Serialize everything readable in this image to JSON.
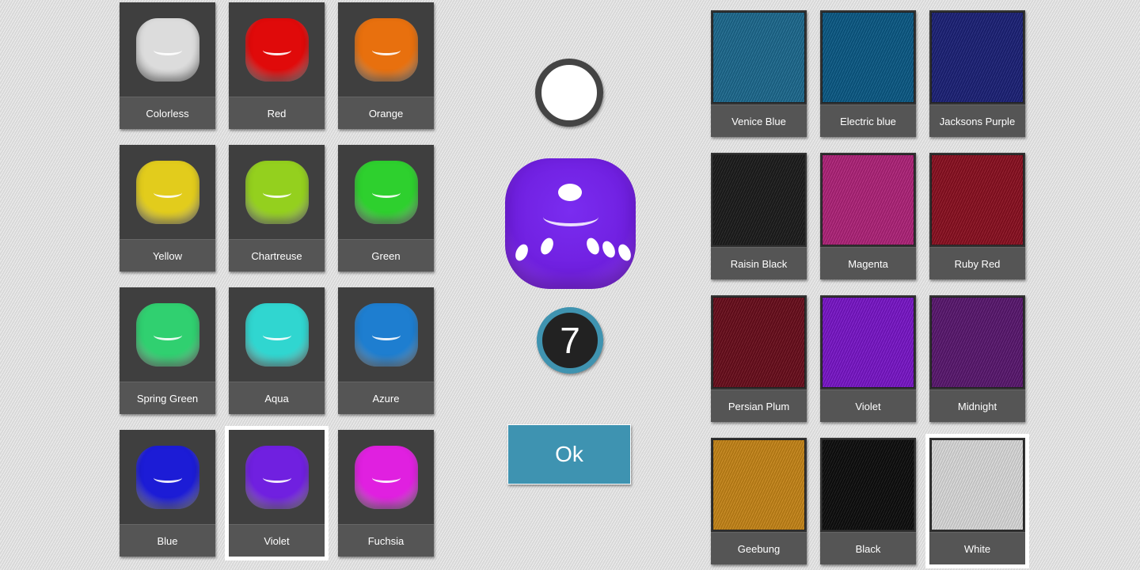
{
  "dice_colors": [
    {
      "label": "Colorless",
      "color": "#dcdcdc"
    },
    {
      "label": "Red",
      "color": "#e00a0a"
    },
    {
      "label": "Orange",
      "color": "#e8700e"
    },
    {
      "label": "Yellow",
      "color": "#e2cc1c"
    },
    {
      "label": "Chartreuse",
      "color": "#94d01e"
    },
    {
      "label": "Green",
      "color": "#2ed02e"
    },
    {
      "label": "Spring Green",
      "color": "#30d070"
    },
    {
      "label": "Aqua",
      "color": "#30d6d0"
    },
    {
      "label": "Azure",
      "color": "#1e7ed0"
    },
    {
      "label": "Blue",
      "color": "#1c1cd6"
    },
    {
      "label": "Violet",
      "color": "#7020e0",
      "selected": true
    },
    {
      "label": "Fuchsia",
      "color": "#e020e0"
    }
  ],
  "table_colors": [
    {
      "label": "Venice Blue",
      "color": "#1d6a8f"
    },
    {
      "label": "Electric blue",
      "color": "#0b5a86"
    },
    {
      "label": "Jacksons Purple",
      "color": "#1c2278"
    },
    {
      "label": "Raisin Black",
      "color": "#1c1c1c"
    },
    {
      "label": "Magenta",
      "color": "#b0237a"
    },
    {
      "label": "Ruby Red",
      "color": "#8b1021"
    },
    {
      "label": "Persian Plum",
      "color": "#6a0e1c"
    },
    {
      "label": "Violet",
      "color": "#7a16c9"
    },
    {
      "label": "Midnight",
      "color": "#5a1870"
    },
    {
      "label": "Geebung",
      "color": "#c78618"
    },
    {
      "label": "Black",
      "color": "#0e0e0e"
    },
    {
      "label": "White",
      "color": "#dcdcdc",
      "selected": true
    }
  ],
  "pip_color": "#ffffff",
  "preview": {
    "die_color": "#7020e0",
    "count": "7"
  },
  "ok_label": "Ok"
}
